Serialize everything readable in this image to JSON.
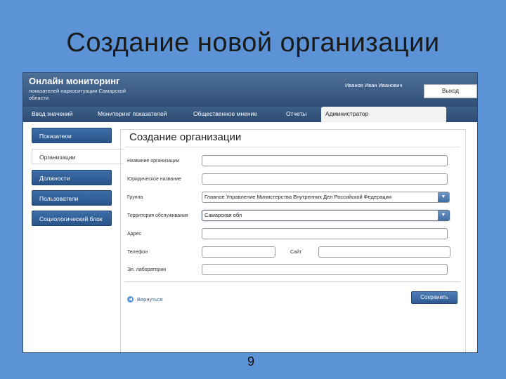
{
  "slide": {
    "title": "Создание новой организации",
    "page_number": "9"
  },
  "app": {
    "title": "Онлайн мониторинг",
    "subtitle": "показателей наркоситуации Самарской области",
    "user_name": "Иванов Иван Иванович",
    "logout_label": "Выход"
  },
  "tabs": [
    {
      "label": "Ввод значений",
      "active": false
    },
    {
      "label": "Мониторинг показателей",
      "active": false
    },
    {
      "label": "Общественное мнение",
      "active": false
    },
    {
      "label": "Отчеты",
      "active": false
    },
    {
      "label": "Администратор",
      "active": true
    }
  ],
  "sidebar": {
    "items": [
      {
        "label": "Показатели",
        "active": false
      },
      {
        "label": "Организации",
        "active": true
      },
      {
        "label": "Должности",
        "active": false
      },
      {
        "label": "Пользователи",
        "active": false
      },
      {
        "label": "Социологический блок",
        "active": false
      }
    ]
  },
  "form": {
    "title": "Создание организации",
    "fields": {
      "name": {
        "label": "Название организации",
        "value": ""
      },
      "legal_name": {
        "label": "Юридическое название",
        "value": ""
      },
      "group": {
        "label": "Группа",
        "value": "Главное Управление Министерства Внутренних Дел Российской Федерации"
      },
      "territory": {
        "label": "Территория обслуживания",
        "value": "Самарская обл"
      },
      "address": {
        "label": "Адрес",
        "value": ""
      },
      "phone": {
        "label": "Телефон",
        "value": ""
      },
      "site": {
        "label": "Сайт",
        "value": ""
      },
      "email": {
        "label": "Эл. лаборатории",
        "value": ""
      }
    },
    "back_label": "Вернуться",
    "create_label": "Сохранить"
  },
  "colors": {
    "slide_background": "#5b93d6",
    "header": "#2f4f78",
    "button": "#2e5a91"
  }
}
